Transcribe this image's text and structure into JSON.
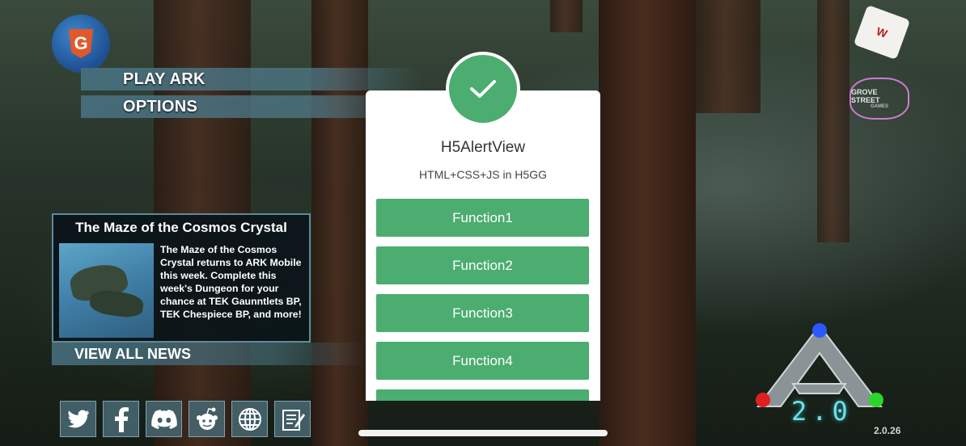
{
  "menu": {
    "play_label": "PLAY ARK",
    "options_label": "OPTIONS"
  },
  "news": {
    "title": "The Maze of the Cosmos Crystal",
    "body": "The Maze of the Cosmos Crystal returns to ARK Mobile this week. Complete this week's Dungeon for your chance at TEK Gaunntlets BP, TEK Chespiece BP, and more!",
    "view_all_label": "VIEW ALL NEWS"
  },
  "social_icons": [
    "twitter-icon",
    "facebook-icon",
    "discord-icon",
    "reddit-icon",
    "globe-icon",
    "notes-icon"
  ],
  "logos": {
    "h5gg_letter": "G",
    "wildcard_text": "W",
    "grove_street_line1": "GROVE STREET",
    "grove_street_line2": "GAMES"
  },
  "version": {
    "big": "2.0",
    "small": "2.0.26"
  },
  "alert": {
    "title": "H5AlertView",
    "subtitle": "HTML+CSS+JS in H5GG",
    "buttons": [
      "Function1",
      "Function2",
      "Function3",
      "Function4",
      ""
    ],
    "accent_color": "#4bad6f"
  }
}
